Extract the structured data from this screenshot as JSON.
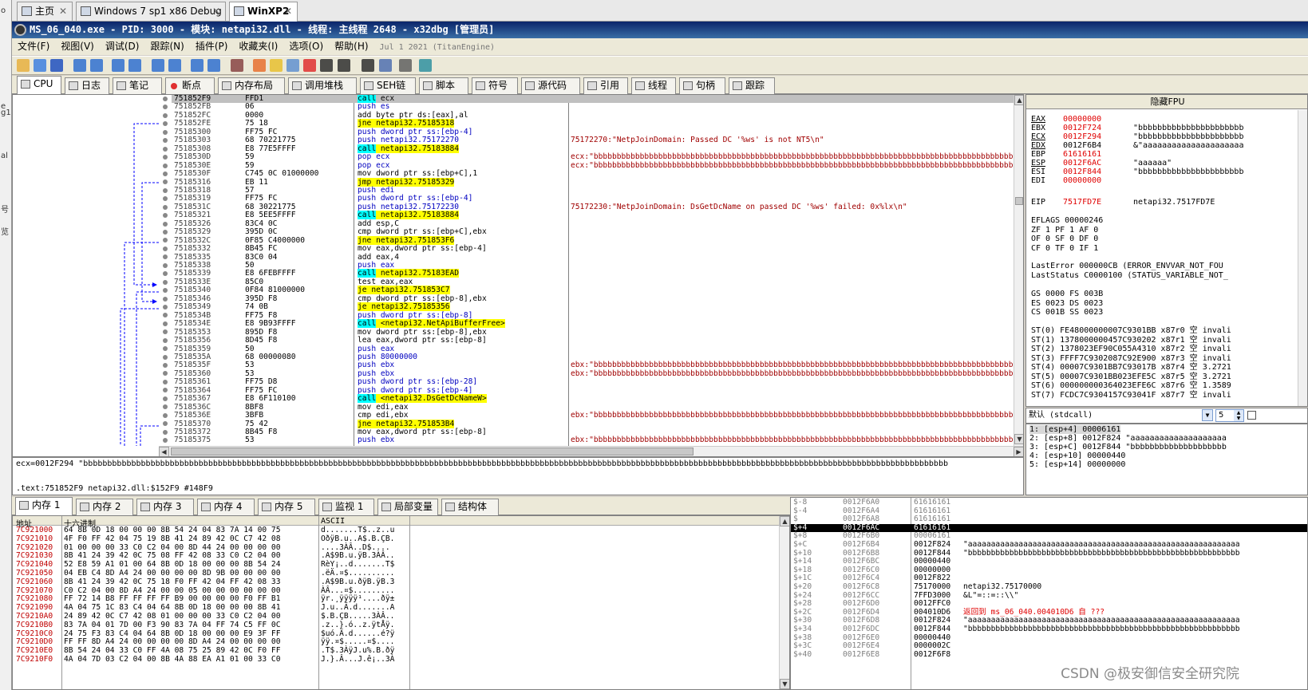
{
  "left_strip": [
    "o",
    "e",
    "g1",
    "al",
    "号",
    "览"
  ],
  "vm_tabs": [
    {
      "label": "主页",
      "close": "✕"
    },
    {
      "label": "Windows 7 sp1 x86 Debug",
      "close": "✕"
    },
    {
      "label": "WinXP2",
      "close": "✕"
    }
  ],
  "title": "MS_06_040.exe - PID: 3000 - 模块: netapi32.dll - 线程: 主线程 2648 - x32dbg [管理员]",
  "menu": [
    "文件(F)",
    "视图(V)",
    "调试(D)",
    "跟踪(N)",
    "插件(P)",
    "收藏夹(I)",
    "选项(O)",
    "帮助(H)"
  ],
  "build_date": "Jul 1 2021 (TitanEngine)",
  "main_tabs": [
    "CPU",
    "日志",
    "笔记",
    "断点",
    "内存布局",
    "调用堆栈",
    "SEH链",
    "脚本",
    "符号",
    "源代码",
    "引用",
    "线程",
    "句柄",
    "跟踪"
  ],
  "disasm": [
    {
      "addr": "751852F9",
      "bytes": "FFD1",
      "ins": [
        [
          "call",
          "c"
        ],
        [
          " ecx",
          ""
        ]
      ],
      "cm": ""
    },
    {
      "addr": "751852FB",
      "bytes": "06",
      "ins": [
        [
          "push es",
          "p"
        ]
      ],
      "cm": ""
    },
    {
      "addr": "751852FC",
      "bytes": "0000",
      "ins": [
        [
          "add byte ptr ds:[eax],al",
          ""
        ]
      ],
      "cm": ""
    },
    {
      "addr": "751852FE",
      "bytes": "75 18",
      "ins": [
        [
          "jne",
          "y"
        ],
        [
          " netapi32.75185318",
          "y"
        ]
      ],
      "cm": ""
    },
    {
      "addr": "75185300",
      "bytes": "FF75 FC",
      "ins": [
        [
          "push dword ptr ss:[ebp-4]",
          "p"
        ]
      ],
      "cm": ""
    },
    {
      "addr": "75185303",
      "bytes": "68 70221775",
      "ins": [
        [
          "push netapi32.75172270",
          "p"
        ]
      ],
      "cm": "75172270:\"NetpJoinDomain: Passed DC '%ws' is not NT5\\n\""
    },
    {
      "addr": "75185308",
      "bytes": "E8 77E5FFFF",
      "ins": [
        [
          "call",
          "c"
        ],
        [
          " netapi32.75183884",
          "y"
        ]
      ],
      "cm": ""
    },
    {
      "addr": "7518530D",
      "bytes": "59",
      "ins": [
        [
          "pop ecx",
          "p"
        ]
      ],
      "cm": "ecx:\"bbbbbbbbbbbbbbbbbbbbbbbbbbbbbbbbbbbbbbbbbbbbbbbbbbbbbbbbbbbbbbbbbbbbbbbbbbbbbbbbbbbbbbbbbbbb"
    },
    {
      "addr": "7518530E",
      "bytes": "59",
      "ins": [
        [
          "pop ecx",
          "p"
        ]
      ],
      "cm": "ecx:\"bbbbbbbbbbbbbbbbbbbbbbbbbbbbbbbbbbbbbbbbbbbbbbbbbbbbbbbbbbbbbbbbbbbbbbbbbbbbbbbbbbbbbbbbbbbb"
    },
    {
      "addr": "7518530F",
      "bytes": "C745 0C 01000000",
      "ins": [
        [
          "mov dword ptr ss:[ebp+C],1",
          ""
        ]
      ],
      "cm": ""
    },
    {
      "addr": "75185316",
      "bytes": "EB 11",
      "ins": [
        [
          "jmp",
          "y"
        ],
        [
          " netapi32.75185329",
          "y"
        ]
      ],
      "cm": ""
    },
    {
      "addr": "75185318",
      "bytes": "57",
      "ins": [
        [
          "push edi",
          "p"
        ]
      ],
      "cm": ""
    },
    {
      "addr": "75185319",
      "bytes": "FF75 FC",
      "ins": [
        [
          "push dword ptr ss:[ebp-4]",
          "p"
        ]
      ],
      "cm": ""
    },
    {
      "addr": "7518531C",
      "bytes": "68 30221775",
      "ins": [
        [
          "push netapi32.75172230",
          "p"
        ]
      ],
      "cm": "75172230:\"NetpJoinDomain: DsGetDcName on passed DC '%ws' failed: 0x%lx\\n\""
    },
    {
      "addr": "75185321",
      "bytes": "E8 5EE5FFFF",
      "ins": [
        [
          "call",
          "c"
        ],
        [
          " netapi32.75183884",
          "y"
        ]
      ],
      "cm": ""
    },
    {
      "addr": "75185326",
      "bytes": "83C4 0C",
      "ins": [
        [
          "add esp,C",
          ""
        ]
      ],
      "cm": ""
    },
    {
      "addr": "75185329",
      "bytes": "395D 0C",
      "ins": [
        [
          "cmp dword ptr ss:[ebp+C],ebx",
          ""
        ]
      ],
      "cm": ""
    },
    {
      "addr": "7518532C",
      "bytes": "0F85 C4000000",
      "ins": [
        [
          "jne",
          "y"
        ],
        [
          " netapi32.751853F6",
          "y"
        ]
      ],
      "cm": ""
    },
    {
      "addr": "75185332",
      "bytes": "8B45 FC",
      "ins": [
        [
          "mov eax,dword ptr ss:[ebp-4]",
          ""
        ]
      ],
      "cm": ""
    },
    {
      "addr": "75185335",
      "bytes": "83C0 04",
      "ins": [
        [
          "add eax,4",
          ""
        ]
      ],
      "cm": ""
    },
    {
      "addr": "75185338",
      "bytes": "50",
      "ins": [
        [
          "push eax",
          "p"
        ]
      ],
      "cm": ""
    },
    {
      "addr": "75185339",
      "bytes": "E8 6FEBFFFF",
      "ins": [
        [
          "call",
          "c"
        ],
        [
          " netapi32.75183EAD",
          "y"
        ]
      ],
      "cm": ""
    },
    {
      "addr": "7518533E",
      "bytes": "85C0",
      "ins": [
        [
          "test eax,eax",
          ""
        ]
      ],
      "cm": ""
    },
    {
      "addr": "75185340",
      "bytes": "0F84 81000000",
      "ins": [
        [
          "je",
          "y"
        ],
        [
          " netapi32.751853C7",
          "y"
        ]
      ],
      "cm": ""
    },
    {
      "addr": "75185346",
      "bytes": "395D F8",
      "ins": [
        [
          "cmp dword ptr ss:[ebp-8],ebx",
          ""
        ]
      ],
      "cm": ""
    },
    {
      "addr": "75185349",
      "bytes": "74 0B",
      "ins": [
        [
          "je",
          "y"
        ],
        [
          " netapi32.75185356",
          "y"
        ]
      ],
      "cm": ""
    },
    {
      "addr": "7518534B",
      "bytes": "FF75 F8",
      "ins": [
        [
          "push dword ptr ss:[ebp-8]",
          "p"
        ]
      ],
      "cm": ""
    },
    {
      "addr": "7518534E",
      "bytes": "E8 9B93FFFF",
      "ins": [
        [
          "call",
          "c"
        ],
        [
          " <netapi32.NetApiBufferFree>",
          "y"
        ]
      ],
      "cm": ""
    },
    {
      "addr": "75185353",
      "bytes": "895D F8",
      "ins": [
        [
          "mov dword ptr ss:[ebp-8],ebx",
          ""
        ]
      ],
      "cm": ""
    },
    {
      "addr": "75185356",
      "bytes": "8D45 F8",
      "ins": [
        [
          "lea eax,dword ptr ss:[ebp-8]",
          ""
        ]
      ],
      "cm": ""
    },
    {
      "addr": "75185359",
      "bytes": "50",
      "ins": [
        [
          "push eax",
          "p"
        ]
      ],
      "cm": ""
    },
    {
      "addr": "7518535A",
      "bytes": "68 00000080",
      "ins": [
        [
          "push 80000000",
          "p"
        ]
      ],
      "cm": ""
    },
    {
      "addr": "7518535F",
      "bytes": "53",
      "ins": [
        [
          "push ebx",
          "p"
        ]
      ],
      "cm": "ebx:\"bbbbbbbbbbbbbbbbbbbbbbbbbbbbbbbbbbbbbbbbbbbbbbbbbbbbbbbbbbbbbbbbbbbbbbbbbbbbbbbbbbbbbbbbbbbb"
    },
    {
      "addr": "75185360",
      "bytes": "53",
      "ins": [
        [
          "push ebx",
          "p"
        ]
      ],
      "cm": "ebx:\"bbbbbbbbbbbbbbbbbbbbbbbbbbbbbbbbbbbbbbbbbbbbbbbbbbbbbbbbbbbbbbbbbbbbbbbbbbbbbbbbbbbbbbbbbbbb"
    },
    {
      "addr": "75185361",
      "bytes": "FF75 D8",
      "ins": [
        [
          "push dword ptr ss:[ebp-28]",
          "p"
        ]
      ],
      "cm": ""
    },
    {
      "addr": "75185364",
      "bytes": "FF75 FC",
      "ins": [
        [
          "push dword ptr ss:[ebp-4]",
          "p"
        ]
      ],
      "cm": ""
    },
    {
      "addr": "75185367",
      "bytes": "E8 6F110100",
      "ins": [
        [
          "call",
          "c"
        ],
        [
          " <netapi32.DsGetDcNameW>",
          "y"
        ]
      ],
      "cm": ""
    },
    {
      "addr": "7518536C",
      "bytes": "8BF8",
      "ins": [
        [
          "mov edi,eax",
          ""
        ]
      ],
      "cm": ""
    },
    {
      "addr": "7518536E",
      "bytes": "3BFB",
      "ins": [
        [
          "cmp edi,ebx",
          ""
        ]
      ],
      "cm": "ebx:\"bbbbbbbbbbbbbbbbbbbbbbbbbbbbbbbbbbbbbbbbbbbbbbbbbbbbbbbbbbbbbbbbbbbbbbbbbbbbbbbbbbbbbbbbbbbb"
    },
    {
      "addr": "75185370",
      "bytes": "75 42",
      "ins": [
        [
          "jne",
          "y"
        ],
        [
          " netapi32.751853B4",
          "y"
        ]
      ],
      "cm": ""
    },
    {
      "addr": "75185372",
      "bytes": "8B45 F8",
      "ins": [
        [
          "mov eax,dword ptr ss:[ebp-8]",
          ""
        ]
      ],
      "cm": ""
    },
    {
      "addr": "75185375",
      "bytes": "53",
      "ins": [
        [
          "push ebx",
          "p"
        ]
      ],
      "cm": "ebx:\"bbbbbbbbbbbbbbbbbbbbbbbbbbbbbbbbbbbbbbbbbbbbbbbbbbbbbbbbbbbbbbbbbbbbbbbbbbbbbbbbbbbbbbbbbbbb"
    }
  ],
  "info": {
    "line1": "ecx=0012F294 \"bbbbbbbbbbbbbbbbbbbbbbbbbbbbbbbbbbbbbbbbbbbbbbbbbbbbbbbbbbbbbbbbbbbbbbbbbbbbbbbbbbbbbbbbbbbbbbbbbbbbbbbbbbbbbbbbbbbbbbbbbbbbbbbbbbbbbbbbbbbbbbbbbbbbbbbbbbbbbbbbbbbbbbbbbbbbbbbbbbbb",
    "line2": ".text:751852F9 netapi32.dll:$152F9 #148F9"
  },
  "regs_header": "隐藏FPU",
  "registers": [
    {
      "name": "EAX",
      "val": "00000000",
      "cm": "",
      "u": true,
      "r": true
    },
    {
      "name": "EBX",
      "val": "0012F724",
      "cm": "\"bbbbbbbbbbbbbbbbbbbbbb",
      "u": false,
      "r": true
    },
    {
      "name": "ECX",
      "val": "0012F294",
      "cm": "\"bbbbbbbbbbbbbbbbbbbbbb",
      "u": true,
      "r": true
    },
    {
      "name": "EDX",
      "val": "0012F6B4",
      "cm": "&\"aaaaaaaaaaaaaaaaaaaaa",
      "u": true,
      "r": false
    },
    {
      "name": "EBP",
      "val": "61616161",
      "cm": "",
      "u": false,
      "r": true
    },
    {
      "name": "ESP",
      "val": "0012F6AC",
      "cm": "\"aaaaaa\"",
      "u": true,
      "r": true
    },
    {
      "name": "ESI",
      "val": "0012F844",
      "cm": "\"bbbbbbbbbbbbbbbbbbbbbb",
      "u": false,
      "r": true
    },
    {
      "name": "EDI",
      "val": "00000000",
      "cm": "",
      "u": false,
      "r": true
    }
  ],
  "eip": {
    "name": "EIP",
    "val": "7517FD7E",
    "cm": "netapi32.7517FD7E"
  },
  "flags": [
    "EFLAGS   00000246",
    "ZF 1  PF 1  AF 0",
    "OF 0  SF 0  DF 0",
    "CF 0  TF 0  IF 1"
  ],
  "lasterr": [
    "LastError  000000CB (ERROR_ENVVAR_NOT_FOU",
    "LastStatus C0000100 (STATUS_VARIABLE_NOT_"
  ],
  "segs": [
    "GS 0000  FS 003B",
    "ES 0023  DS 0023",
    "CS 001B  SS 0023"
  ],
  "fpu": [
    "ST(0) FE48000000007C9301BB x87r0 空 invali",
    "ST(1) 1378000000457C930202 x87r1 空 invali",
    "ST(2) 1378023EF90C055A4310 x87r2 空 invali",
    "ST(3) FFFF7C9302087C92E900 x87r3 空 invali",
    "ST(4) 00007C9301BB7C93017B x87r4 空 3.2721",
    "ST(5) 00007C9301BB023EFE5C x87r5 空 3.2721",
    "ST(6) 000000000364023EFE6C x87r6 空 1.3589",
    "ST(7) FCDC7C9304157C93041F x87r7 空 invali"
  ],
  "callconv": {
    "label": "默认 (stdcall)",
    "count": "5"
  },
  "stack_args": [
    "1: [esp+4]  00006161",
    "2: [esp+8]  0012F824 \"aaaaaaaaaaaaaaaaaaaa",
    "3: [esp+C]  0012F844 \"bbbbbbbbbbbbbbbbbbbb",
    "4: [esp+10] 00000440",
    "5: [esp+14] 00000000"
  ],
  "mem_tabs": [
    "内存 1",
    "内存 2",
    "内存 3",
    "内存 4",
    "内存 5",
    "监视 1",
    "局部变量",
    "结构体"
  ],
  "dump_headers": {
    "addr": "地址",
    "hex": "十六进制",
    "ascii": "ASCII"
  },
  "dump": [
    {
      "a": "7C921000",
      "h": "64 8B 0D 18 00 00 00 8B 54 24 04 83 7A 14 00 75",
      "x": "d.......T$..z..u"
    },
    {
      "a": "7C921010",
      "h": "4F F0 FF 42 04 75 19 8B 41 24 89 42 0C C7 42 08",
      "x": "OðÿB.u..A$.B.ÇB."
    },
    {
      "a": "7C921020",
      "h": "01 00 00 00 33 C0 C2 04 00 8D 44 24 00 00 00 00",
      "x": "....3ÀÂ..D$...."
    },
    {
      "a": "7C921030",
      "h": "8B 41 24 39 42 0C 75 08 FF 42 08 33 C0 C2 04 00",
      "x": ".A$9B.u.ÿB.3ÀÂ.."
    },
    {
      "a": "7C921040",
      "h": "52 E8 59 A1 01 00 64 8B 0D 18 00 00 00 8B 54 24",
      "x": "RèY¡..d.......T$"
    },
    {
      "a": "7C921050",
      "h": "04 EB C4 8D A4 24 00 00 00 00 8D 9B 00 00 00 00",
      "x": ".ëÄ.¤$.........."
    },
    {
      "a": "7C921060",
      "h": "8B 41 24 39 42 0C 75 18 F0 FF 42 04 FF 42 08 33",
      "x": ".A$9B.u.ðÿB.ÿB.3"
    },
    {
      "a": "7C921070",
      "h": "C0 C2 04 00 8D A4 24 00 00 05 00 00 00 00 00 00",
      "x": "ÀÂ...¤$........."
    },
    {
      "a": "7C921080",
      "h": "FF 72 14 B8 FF FF FF FF B9 00 00 00 00 F0 FF B1",
      "x": "ÿr.¸ÿÿÿÿ¹....ðÿ±"
    },
    {
      "a": "7C921090",
      "h": "4A 04 75 1C 83 C4 04 64 8B 0D 18 00 00 00 8B 41",
      "x": "J.u..Ä.d.......A"
    },
    {
      "a": "7C9210A0",
      "h": "24 89 42 0C C7 42 08 01 00 00 00 33 C0 C2 04 00",
      "x": "$.B.ÇB.....3ÀÂ.."
    },
    {
      "a": "7C9210B0",
      "h": "83 7A 04 01 7D 00 F3 90 83 7A 04 FF 74 C5 FF 0C",
      "x": ".z..}.ó..z.ÿtÅÿ."
    },
    {
      "a": "7C9210C0",
      "h": "24 75 F3 83 C4 04 64 8B 0D 18 00 00 00 E9 3F FF",
      "x": "$uó.Ä.d......é?ÿ"
    },
    {
      "a": "7C9210D0",
      "h": "FF FF 8D A4 24 00 00 00 00 8D A4 24 00 00 00 00",
      "x": "ÿÿ.¤$.....¤$...."
    },
    {
      "a": "7C9210E0",
      "h": "8B 54 24 04 33 C0 FF 4A 08 75 25 89 42 0C F0 FF",
      "x": ".T$.3ÀÿJ.u%.B.ðÿ"
    },
    {
      "a": "7C9210F0",
      "h": "4A 04 7D 03 C2 04 00 8B 4A 88 EA A1 01 00 33 C0",
      "x": "J.}.Â...J.ê¡..3À"
    }
  ],
  "stack": [
    {
      "o": "$-8",
      "a": "0012F6A0",
      "v": "61616161",
      "c": "",
      "cur": false
    },
    {
      "o": "$-4",
      "a": "0012F6A4",
      "v": "61616161",
      "c": "",
      "cur": false
    },
    {
      "o": "$",
      "a": "0012F6A8",
      "v": "61616161",
      "c": "",
      "cur": false
    },
    {
      "o": "$+4",
      "a": "0012F6AC",
      "v": "61616161",
      "c": "",
      "cur": true
    },
    {
      "o": "$+8",
      "a": "0012F6B0",
      "v": "00006161",
      "c": "",
      "cur": false
    },
    {
      "o": "$+C",
      "a": "0012F6B4",
      "v": "0012F824",
      "c": "\"aaaaaaaaaaaaaaaaaaaaaaaaaaaaaaaaaaaaaaaaaaaaaaaaaaaaaaaaaaa",
      "cur": false
    },
    {
      "o": "$+10",
      "a": "0012F6B8",
      "v": "0012F844",
      "c": "\"bbbbbbbbbbbbbbbbbbbbbbbbbbbbbbbbbbbbbbbbbbbbbbbbbbbbbbbbbbb",
      "cur": false
    },
    {
      "o": "$+14",
      "a": "0012F6BC",
      "v": "00000440",
      "c": "",
      "cur": false
    },
    {
      "o": "$+18",
      "a": "0012F6C0",
      "v": "00000000",
      "c": "",
      "cur": false
    },
    {
      "o": "$+1C",
      "a": "0012F6C4",
      "v": "0012F822",
      "c": "",
      "cur": false
    },
    {
      "o": "$+20",
      "a": "0012F6C8",
      "v": "75170000",
      "c": "netapi32.75170000",
      "cur": false
    },
    {
      "o": "$+24",
      "a": "0012F6CC",
      "v": "7FFD3000",
      "c": "&L\"=::=::\\\\\"",
      "cur": false
    },
    {
      "o": "$+28",
      "a": "0012F6D0",
      "v": "0012FFC0",
      "c": "",
      "cur": false
    },
    {
      "o": "$+2C",
      "a": "0012F6D4",
      "v": "004010D6",
      "c": "返回到 ms_06_040.004010D6 自 ???",
      "cur": false,
      "red": true
    },
    {
      "o": "$+30",
      "a": "0012F6D8",
      "v": "0012F824",
      "c": "\"aaaaaaaaaaaaaaaaaaaaaaaaaaaaaaaaaaaaaaaaaaaaaaaaaaaaaaaaaaa",
      "cur": false
    },
    {
      "o": "$+34",
      "a": "0012F6DC",
      "v": "0012F844",
      "c": "\"bbbbbbbbbbbbbbbbbbbbbbbbbbbbbbbbbbbbbbbbbbbbbbbbbbbbbbbbbbb",
      "cur": false
    },
    {
      "o": "$+38",
      "a": "0012F6E0",
      "v": "00000440",
      "c": "",
      "cur": false
    },
    {
      "o": "$+3C",
      "a": "0012F6E4",
      "v": "0000002C",
      "c": "",
      "cur": false
    },
    {
      "o": "$+40",
      "a": "0012F6E8",
      "v": "0012F6F8",
      "c": "",
      "cur": false
    }
  ],
  "watermark": "CSDN @极安御信安全研究院"
}
